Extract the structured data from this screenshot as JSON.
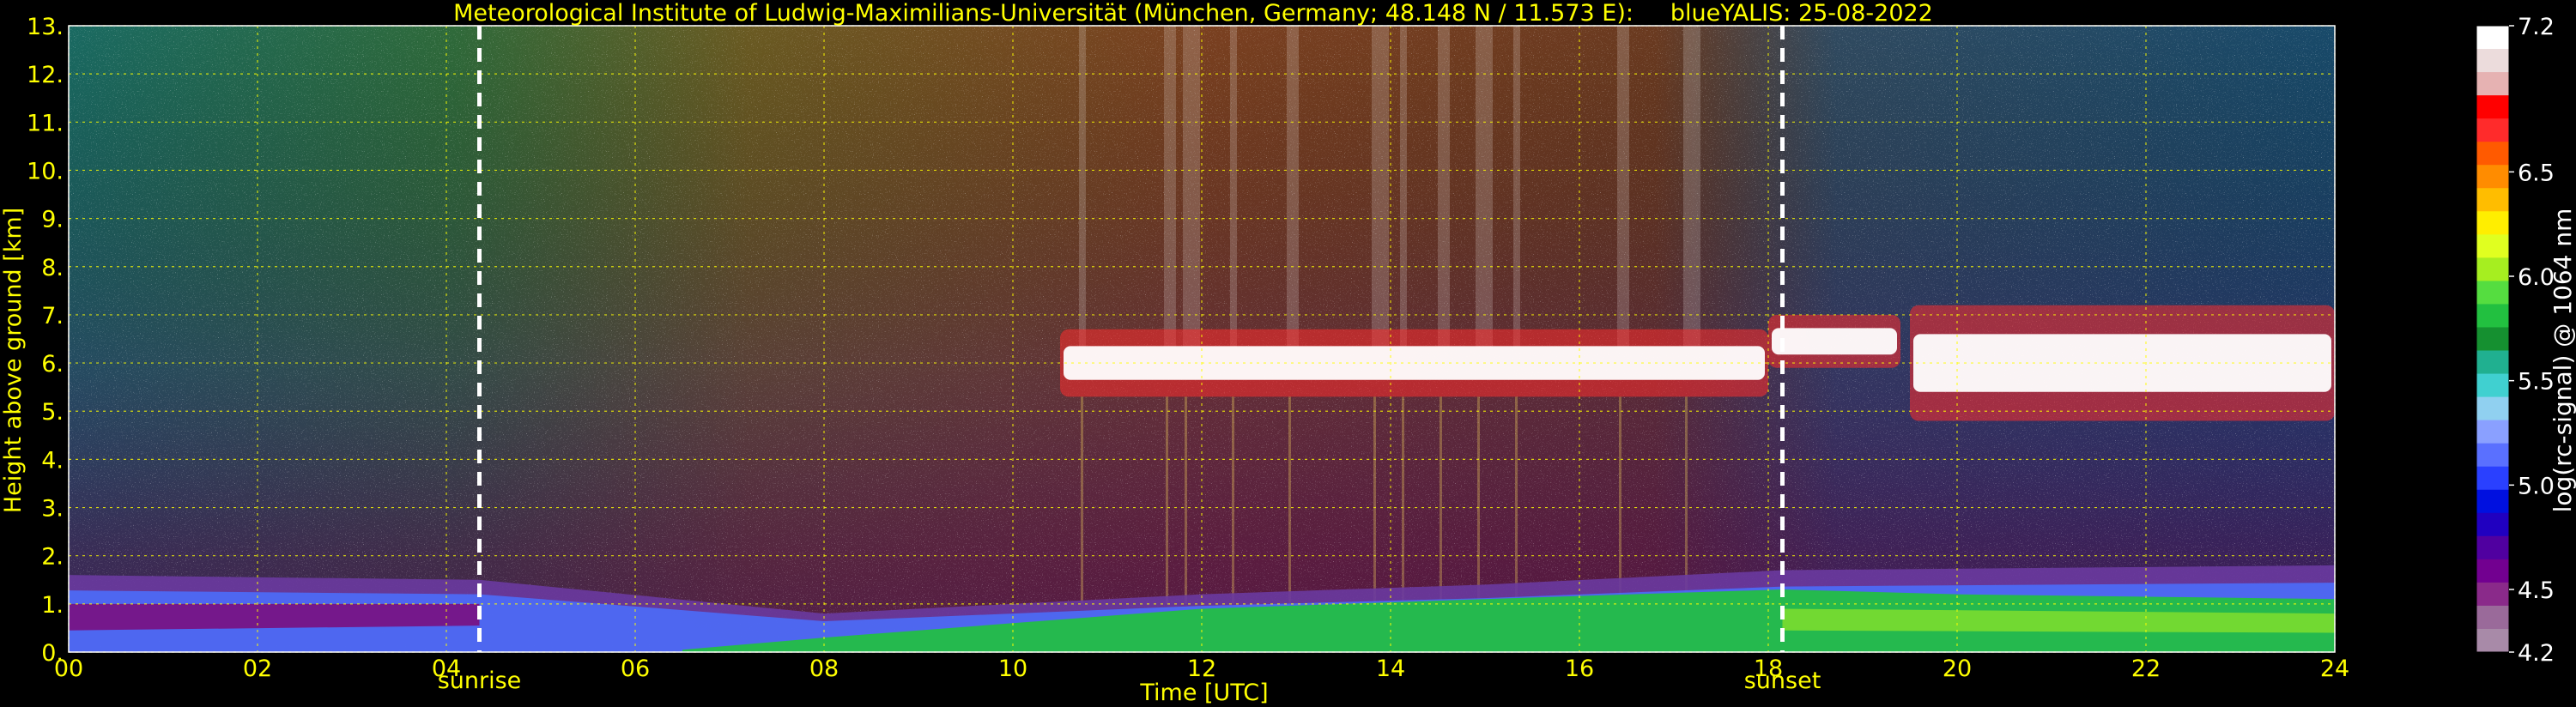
{
  "chart_data": {
    "type": "heatmap",
    "title": "Meteorological Institute of Ludwig-Maximilians-Universität (München, Germany; 48.148 N / 11.573 E):     blueYALIS: 25-08-2022",
    "xlabel": "Time [UTC]",
    "ylabel": "Height above ground [km]",
    "xlim": [
      0,
      24
    ],
    "ylim": [
      0,
      13
    ],
    "x_ticks": [
      "00",
      "02",
      "04",
      "06",
      "08",
      "10",
      "12",
      "14",
      "16",
      "18",
      "20",
      "22",
      "24"
    ],
    "y_ticks": [
      "0.",
      "1.",
      "2.",
      "3.",
      "4.",
      "5.",
      "6.",
      "7.",
      "8.",
      "9.",
      "10.",
      "11.",
      "12.",
      "13."
    ],
    "grid": true,
    "markers": [
      {
        "label": "sunrise",
        "x": 4.35
      },
      {
        "label": "sunset",
        "x": 18.15
      }
    ],
    "colorbar": {
      "label": "log(rc-signal) @ 1064 nm",
      "range": [
        4.2,
        7.2
      ],
      "ticks": [
        "7.2",
        "6.5",
        "6.0",
        "5.5",
        "5.0",
        "4.5",
        "4.2"
      ],
      "colors": [
        "#ffffff",
        "#ecdcdc",
        "#e6b2b2",
        "#ff0000",
        "#ff2b2b",
        "#ff5a00",
        "#ff8c00",
        "#ffbd00",
        "#ffee00",
        "#e0ff20",
        "#a6ee20",
        "#55dd40",
        "#22c040",
        "#159030",
        "#20b090",
        "#40d0d0",
        "#90d0f0",
        "#8aa0ff",
        "#5a70ff",
        "#2a40ff",
        "#0010e0",
        "#2000c0",
        "#5000a0",
        "#720090",
        "#8a2a8a",
        "#9a6a9a",
        "#a88aa8"
      ]
    },
    "cloud_layers": [
      {
        "start": 10.5,
        "end": 18.0,
        "base_km": 5.3,
        "top_km": 6.7
      },
      {
        "start": 18.0,
        "end": 19.4,
        "base_km": 5.9,
        "top_km": 7.0
      },
      {
        "start": 19.5,
        "end": 24.0,
        "base_km": 4.8,
        "top_km": 7.2
      }
    ],
    "boundary_layer": [
      {
        "x": 0,
        "top_km": 1.6
      },
      {
        "x": 4.35,
        "top_km": 1.5
      },
      {
        "x": 8,
        "top_km": 0.8
      },
      {
        "x": 12,
        "top_km": 1.2
      },
      {
        "x": 15,
        "top_km": 1.4
      },
      {
        "x": 18.15,
        "top_km": 1.7
      },
      {
        "x": 24,
        "top_km": 1.8
      }
    ]
  }
}
